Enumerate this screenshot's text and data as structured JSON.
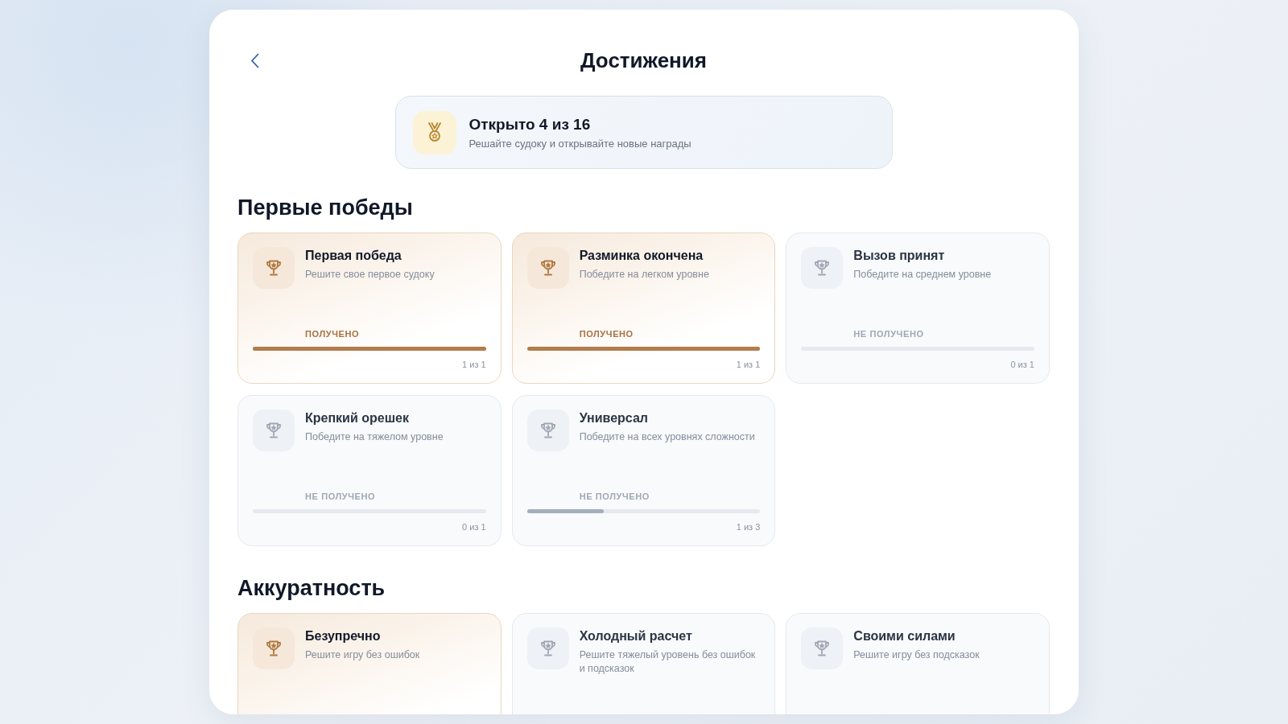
{
  "page": {
    "title": "Достижения"
  },
  "summary": {
    "title": "Открыто 4 из 16",
    "subtitle": "Решайте судоку и открывайте новые награды"
  },
  "sections": [
    {
      "title": "Первые победы",
      "items": [
        {
          "title": "Первая победа",
          "description": "Решите свое первое судоку",
          "earned": true,
          "status": "ПОЛУЧЕНО",
          "level": 1,
          "count": "1 из 1"
        },
        {
          "title": "Разминка окончена",
          "description": "Победите на легком уровне",
          "earned": true,
          "status": "ПОЛУЧЕНО",
          "level": 1,
          "count": "1 из 1"
        },
        {
          "title": "Вызов принят",
          "description": "Победите на среднем уровне",
          "earned": false,
          "status": "НЕ ПОЛУЧЕНО",
          "level": 0,
          "count": "0 из 1"
        },
        {
          "title": "Крепкий орешек",
          "description": "Победите на тяжелом уровне",
          "earned": false,
          "status": "НЕ ПОЛУЧЕНО",
          "level": 0,
          "count": "0 из 1"
        },
        {
          "title": "Универсал",
          "description": "Победите на всех уровнях сложности",
          "earned": false,
          "status": "НЕ ПОЛУЧЕНО",
          "level": 0.33,
          "count": "1 из 3"
        }
      ]
    },
    {
      "title": "Аккуратность",
      "items": [
        {
          "title": "Безупречно",
          "description": "Решите игру без ошибок",
          "earned": true
        },
        {
          "title": "Холодный расчет",
          "description": "Решите тяжелый уровень без ошибок и подсказок",
          "earned": false
        },
        {
          "title": "Своими силами",
          "description": "Решите игру без подсказок",
          "earned": false
        }
      ]
    }
  ]
}
